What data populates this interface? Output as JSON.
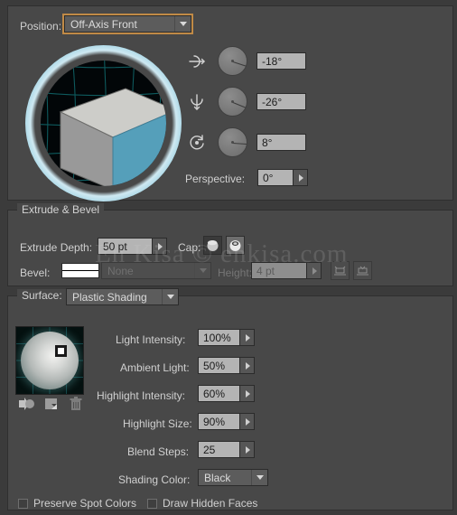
{
  "position": {
    "label": "Position:",
    "value": "Off-Axis Front"
  },
  "rotation": {
    "x_icon": "rotate-x-axis-icon",
    "x_value": "-18°",
    "y_icon": "rotate-y-axis-icon",
    "y_value": "-26°",
    "z_icon": "rotate-z-axis-icon",
    "z_value": "8°",
    "perspective_label": "Perspective:",
    "perspective_value": "0°"
  },
  "extrude": {
    "legend": "Extrude & Bevel",
    "depth_label": "Extrude Depth:",
    "depth_value": "50 pt",
    "cap_label": "Cap:",
    "cap_solid_icon": "cap-solid-icon",
    "cap_hollow_icon": "cap-hollow-icon",
    "bevel_label": "Bevel:",
    "bevel_value": "None",
    "height_label": "Height:",
    "height_value": "4 pt",
    "bevel_extent_out_icon": "bevel-extent-out-icon",
    "bevel_extent_in_icon": "bevel-extent-in-icon"
  },
  "surface": {
    "legend": "Surface:",
    "value": "Plastic Shading",
    "tools": {
      "move_light_icon": "move-light-back-icon",
      "new_light_icon": "new-light-icon",
      "delete_light_icon": "delete-light-trash-icon"
    },
    "fields": [
      {
        "label": "Light Intensity:",
        "value": "100%"
      },
      {
        "label": "Ambient Light:",
        "value": "50%"
      },
      {
        "label": "Highlight Intensity:",
        "value": "60%"
      },
      {
        "label": "Highlight Size:",
        "value": "90%"
      },
      {
        "label": "Blend Steps:",
        "value": "25"
      }
    ],
    "shading_color_label": "Shading Color:",
    "shading_color_value": "Black",
    "preserve_spot_colors": "Preserve Spot Colors",
    "draw_hidden_faces": "Draw Hidden Faces"
  },
  "watermark": "En Kisa © enkisa.com",
  "colors": {
    "dialog_bg": "#484848",
    "window_bg": "#3b3b3b",
    "field_bg": "#b4b4b4",
    "combo_bg": "#5c5c5c",
    "focus_border": "#c08a46",
    "cube_front": "#559fba",
    "cube_left": "#999999",
    "cube_top": "#cdcdc9",
    "text": "#d0d0d0",
    "text_disabled": "#767676"
  }
}
